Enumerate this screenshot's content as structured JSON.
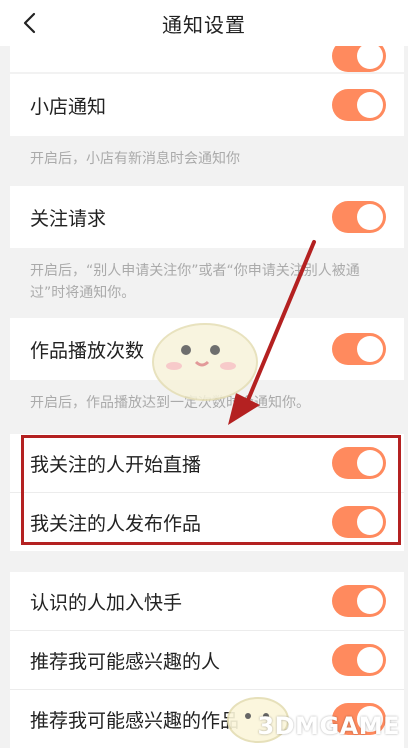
{
  "header": {
    "title": "通知设置"
  },
  "rows": [
    {
      "label": "小店通知",
      "enabled": true,
      "description": "开启后，小店有新消息时会通知你"
    },
    {
      "label": "关注请求",
      "enabled": true,
      "description": "开启后，“别人申请关注你”或者“你申请关注别人被通过”时将通知你。"
    },
    {
      "label": "作品播放次数",
      "enabled": true,
      "description": "开启后，作品播放达到一定次数时会通知你。"
    },
    {
      "label": "我关注的人开始直播",
      "enabled": true
    },
    {
      "label": "我关注的人发布作品",
      "enabled": true
    },
    {
      "label": "认识的人加入快手",
      "enabled": true
    },
    {
      "label": "推荐我可能感兴趣的人",
      "enabled": true
    },
    {
      "label": "推荐我可能感兴趣的作品",
      "enabled": true
    }
  ],
  "watermark": {
    "text": "3DMGAME"
  },
  "colors": {
    "toggle_on": "#ff8a5e",
    "highlight": "#b42121",
    "arrow": "#b42121"
  }
}
